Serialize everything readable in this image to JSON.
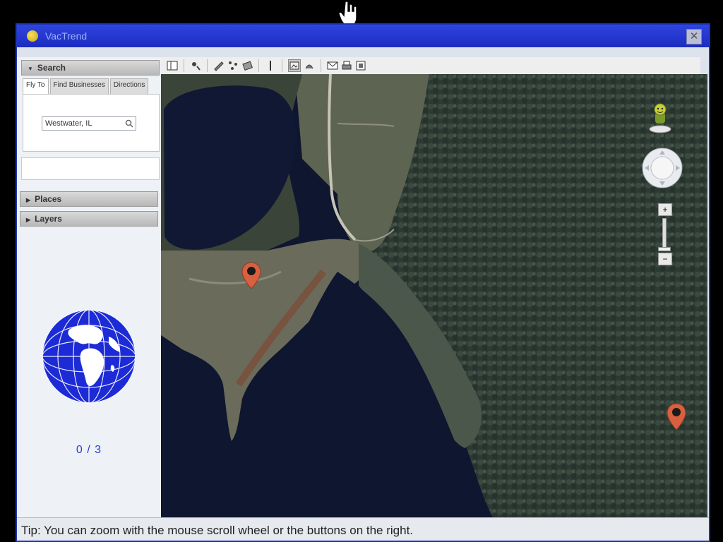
{
  "window": {
    "title": "VacTrend",
    "close_label": "✕"
  },
  "icons": {
    "cursor": "hand-pointer-icon",
    "app": "app-logo-icon",
    "search": "magnifier-icon",
    "globe": "globe-icon",
    "map_pin": "map-marker-icon",
    "street_view": "pegman-icon"
  },
  "sidebar": {
    "search_header": "Search",
    "tabs": [
      {
        "label": "Fly To",
        "active": true
      },
      {
        "label": "Find Businesses",
        "active": false
      },
      {
        "label": "Directions",
        "active": false
      }
    ],
    "search_value": "Westwater, IL",
    "places_header": "Places",
    "layers_header": "Layers",
    "result_count": "0 / 3"
  },
  "map": {
    "zoom_in_label": "+",
    "zoom_out_label": "−",
    "zoom_level": 0.85,
    "pins_count": 2
  },
  "status": {
    "tip": "Tip: You can zoom with the mouse scroll wheel or the buttons on the right."
  },
  "colors": {
    "titlebar": "#1c2cc0",
    "globe": "#1c2bd6",
    "pin": "#d9603f",
    "water": "#0f1630",
    "forest": "#2f3d36"
  }
}
